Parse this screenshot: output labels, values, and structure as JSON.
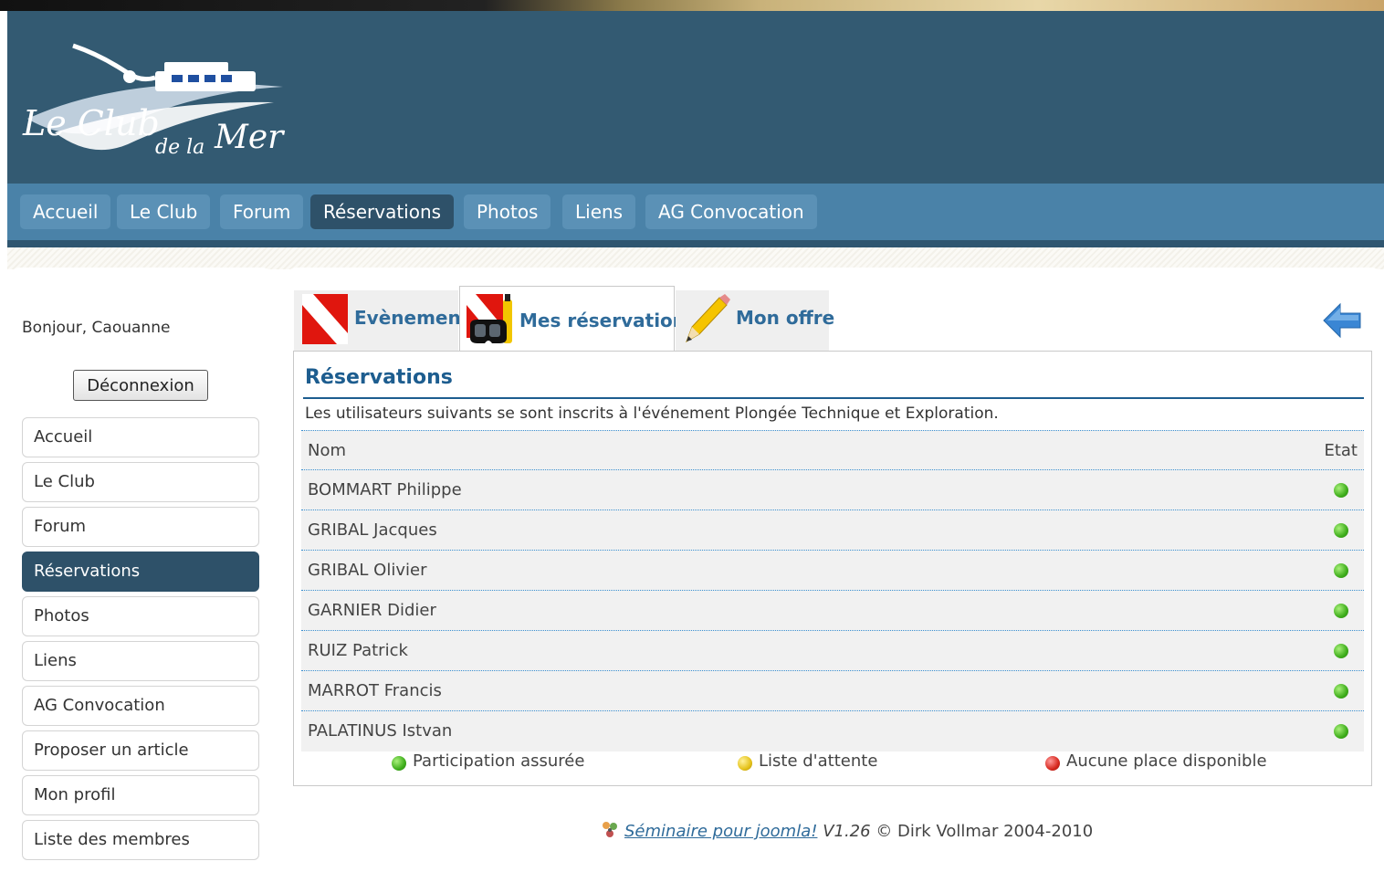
{
  "header": {
    "logo_text": "Le Club de la Mer"
  },
  "nav": {
    "items": [
      {
        "label": "Accueil"
      },
      {
        "label": "Le Club"
      },
      {
        "label": "Forum"
      },
      {
        "label": "Réservations",
        "active": true
      },
      {
        "label": "Photos"
      },
      {
        "label": "Liens"
      },
      {
        "label": "AG Convocation"
      }
    ]
  },
  "sidebar": {
    "greeting": "Bonjour, Caouanne",
    "logout_label": "Déconnexion",
    "items": [
      {
        "label": "Accueil"
      },
      {
        "label": "Le Club"
      },
      {
        "label": "Forum"
      },
      {
        "label": "Réservations",
        "active": true
      },
      {
        "label": "Photos"
      },
      {
        "label": "Liens"
      },
      {
        "label": "AG Convocation"
      },
      {
        "label": "Proposer un article"
      },
      {
        "label": "Mon profil"
      },
      {
        "label": "Liste des membres"
      }
    ]
  },
  "tabs": [
    {
      "label": "Evènement",
      "icon": "dive-flag-icon"
    },
    {
      "label": "Mes réservations",
      "icon": "dive-mask-icon",
      "active": true
    },
    {
      "label": "Mon offre",
      "icon": "pencil-icon"
    }
  ],
  "back_icon": "back-arrow-icon",
  "reservations": {
    "heading": "Réservations",
    "intro": "Les utilisateurs suivants se sont inscrits à l'événement Plongée Technique et Exploration.",
    "col_name": "Nom",
    "col_state": "Etat",
    "rows": [
      {
        "name": "BOMMART Philippe",
        "status": "green"
      },
      {
        "name": "GRIBAL Jacques",
        "status": "green"
      },
      {
        "name": "GRIBAL Olivier",
        "status": "green"
      },
      {
        "name": "GARNIER Didier",
        "status": "green"
      },
      {
        "name": "RUIZ Patrick",
        "status": "green"
      },
      {
        "name": "MARROT Francis",
        "status": "green"
      },
      {
        "name": "PALATINUS Istvan",
        "status": "green"
      }
    ],
    "legend": {
      "green": "Participation assurée",
      "yellow": "Liste d'attente",
      "red": "Aucune place disponible"
    }
  },
  "footer": {
    "link": "Séminaire pour joomla!",
    "version": "V1.26",
    "copyright": "© Dirk Vollmar 2004-2010"
  },
  "colors": {
    "header_bg": "#335a72",
    "nav_bg": "#4a82a8",
    "active_bg": "#2e5169",
    "link": "#2f6b9a",
    "heading": "#1d5d8f"
  }
}
